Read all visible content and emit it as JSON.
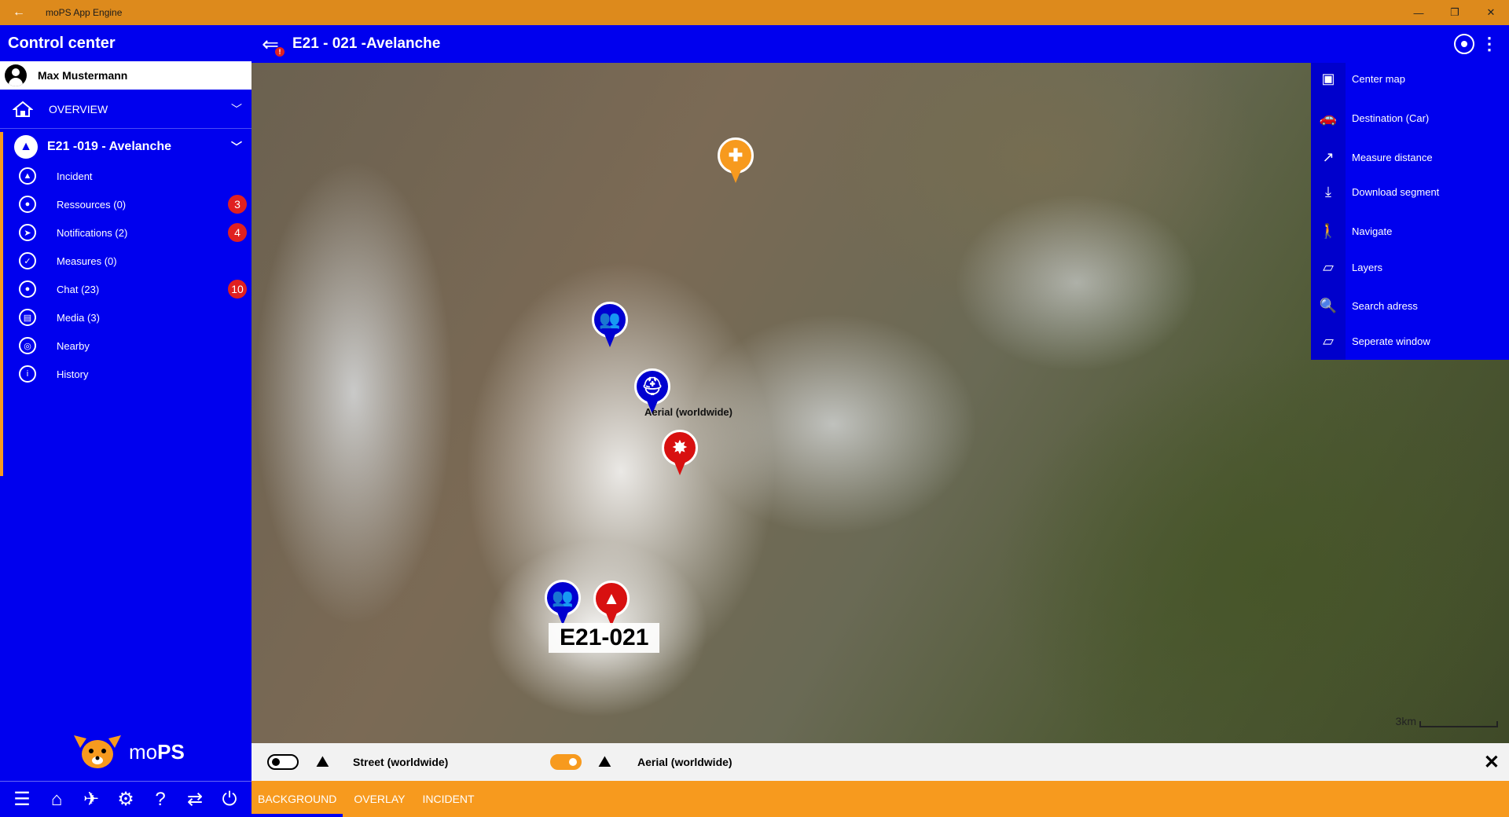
{
  "window": {
    "title": "moPS App Engine",
    "back_icon": "←",
    "minimize": "—",
    "restore": "❐",
    "close": "✕"
  },
  "sidebar": {
    "header": "Control center",
    "user": "Max Mustermann",
    "overview": "OVERVIEW",
    "incident_header": "E21 -019 - Avelanche",
    "items": [
      {
        "label": "Incident",
        "icon": "bell-icon",
        "badge": ""
      },
      {
        "label": "Ressources (0)",
        "icon": "resources-icon",
        "badge": "3"
      },
      {
        "label": "Notifications (2)",
        "icon": "send-icon",
        "badge": "4"
      },
      {
        "label": "Measures (0)",
        "icon": "check-icon",
        "badge": ""
      },
      {
        "label": "Chat (23)",
        "icon": "chat-icon",
        "badge": "10"
      },
      {
        "label": "Media (3)",
        "icon": "media-icon",
        "badge": ""
      },
      {
        "label": "Nearby",
        "icon": "target-icon",
        "badge": ""
      },
      {
        "label": "History",
        "icon": "info-icon",
        "badge": ""
      }
    ],
    "logo_prefix": "mo",
    "logo_suffix": "PS",
    "bottom_nav": [
      "☰",
      "⌂",
      "✈",
      "⚙",
      "?",
      "⇄",
      "⏻"
    ]
  },
  "topbar": {
    "title": "E21 - 021 -Avelanche",
    "back_badge": "!"
  },
  "map": {
    "aerial_label": "Aerial (worldwide)",
    "incident_label": "E21-021",
    "scale_label": "3km"
  },
  "right_menu": [
    {
      "label": "Center map",
      "icon": "▣"
    },
    {
      "label": "Destination (Car)",
      "icon": "🚗"
    },
    {
      "label": "Measure distance",
      "icon": "↗"
    },
    {
      "label": "Download segment",
      "icon": "⤓"
    },
    {
      "label": "Navigate",
      "icon": "🚶"
    },
    {
      "label": "Layers",
      "icon": "▱"
    },
    {
      "label": "Search adress",
      "icon": "🔍"
    },
    {
      "label": "Seperate window",
      "icon": "▱"
    }
  ],
  "layers": {
    "street": {
      "label": "Street (worldwide)",
      "on": false
    },
    "aerial": {
      "label": "Aerial (worldwide)",
      "on": true
    }
  },
  "tabs": [
    {
      "label": "BACKGROUND",
      "active": true
    },
    {
      "label": "OVERLAY",
      "active": false
    },
    {
      "label": "INCIDENT",
      "active": false
    }
  ],
  "colors": {
    "primary": "#0000EE",
    "accent": "#F79A1E",
    "badge": "#E02020"
  }
}
